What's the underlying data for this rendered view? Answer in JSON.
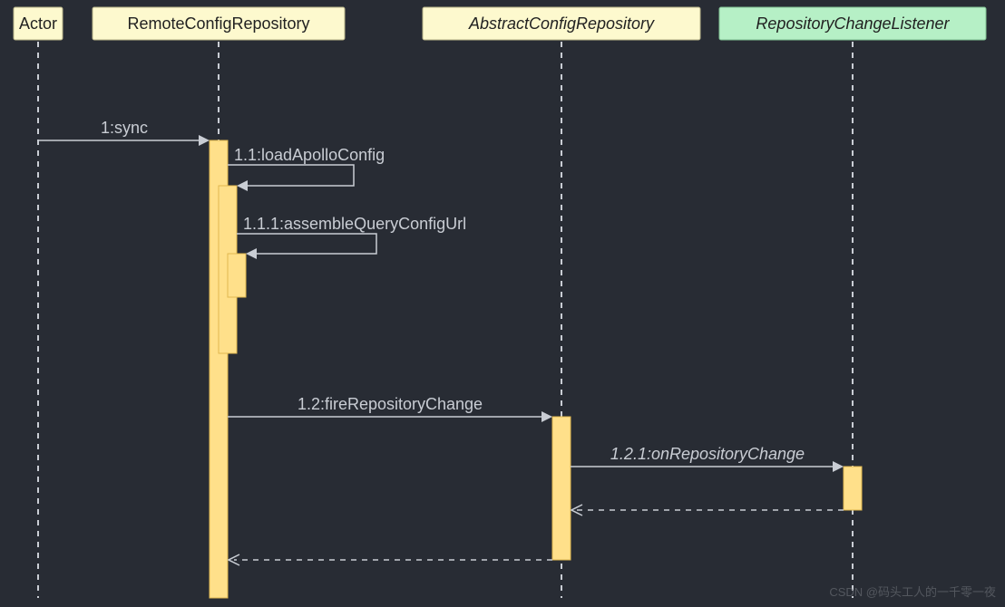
{
  "chart_data": {
    "type": "sequence-diagram",
    "participants": [
      {
        "id": "actor",
        "label": "Actor",
        "style": "normal"
      },
      {
        "id": "remote",
        "label": "RemoteConfigRepository",
        "style": "normal"
      },
      {
        "id": "abstract",
        "label": "AbstractConfigRepository",
        "style": "abstract"
      },
      {
        "id": "listener",
        "label": "RepositoryChangeListener",
        "style": "interface"
      }
    ],
    "messages": [
      {
        "seq": "1",
        "label": "sync",
        "from": "actor",
        "to": "remote",
        "kind": "call"
      },
      {
        "seq": "1.1",
        "label": "loadApolloConfig",
        "from": "remote",
        "to": "remote",
        "kind": "self"
      },
      {
        "seq": "1.1.1",
        "label": "assembleQueryConfigUrl",
        "from": "remote",
        "to": "remote",
        "kind": "self"
      },
      {
        "seq": "1.2",
        "label": "fireRepositoryChange",
        "from": "remote",
        "to": "abstract",
        "kind": "call"
      },
      {
        "seq": "1.2.1",
        "label": "onRepositoryChange",
        "from": "abstract",
        "to": "listener",
        "kind": "call"
      },
      {
        "seq": "",
        "label": "",
        "from": "listener",
        "to": "abstract",
        "kind": "return"
      },
      {
        "seq": "",
        "label": "",
        "from": "abstract",
        "to": "remote",
        "kind": "return"
      }
    ]
  },
  "labels": {
    "p1": "Actor",
    "p2": "RemoteConfigRepository",
    "p3": "AbstractConfigRepository",
    "p4": "RepositoryChangeListener",
    "m1": "1:sync",
    "m2": "1.1:loadApolloConfig",
    "m3": "1.1.1:assembleQueryConfigUrl",
    "m4": "1.2:fireRepositoryChange",
    "m5": "1.2.1:onRepositoryChange"
  },
  "watermark": "CSDN @码头工人的一千零一夜"
}
